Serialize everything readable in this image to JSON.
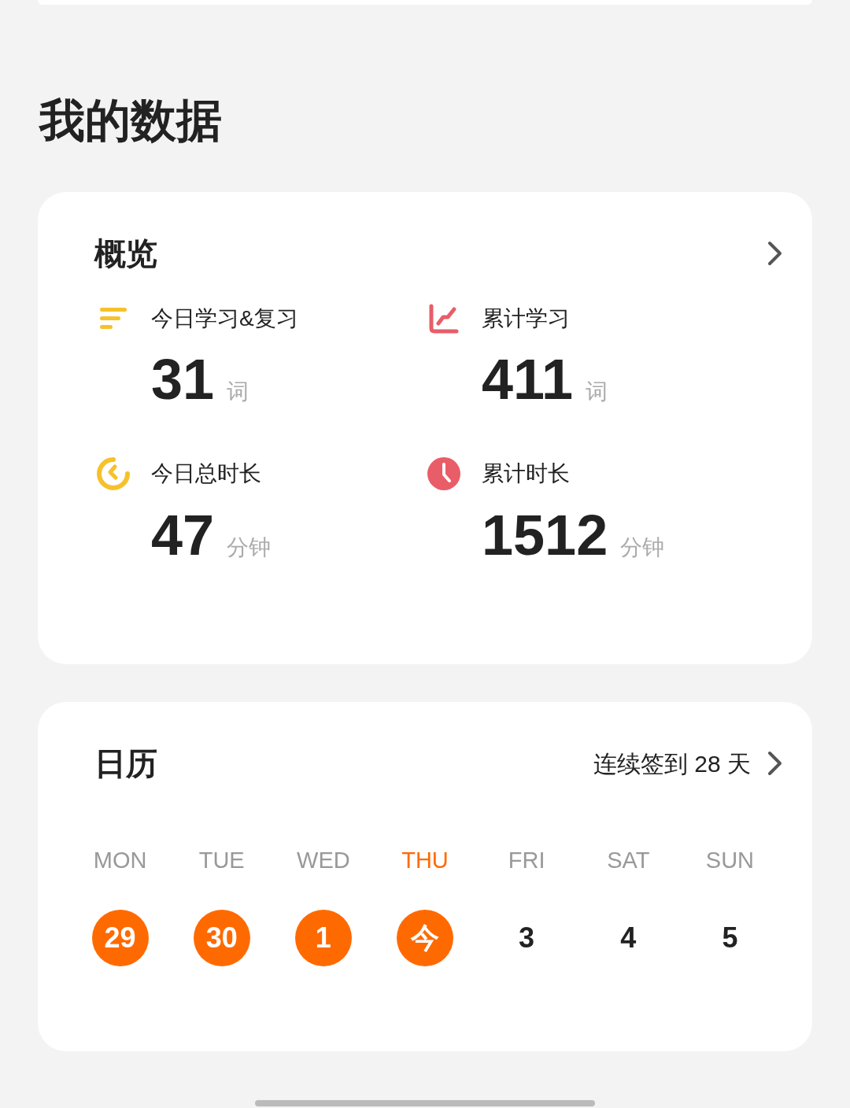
{
  "title": "我的数据",
  "overview": {
    "title": "概览",
    "stats": [
      {
        "kind": "lines",
        "label": "今日学习&复习",
        "value": "31",
        "unit": "词"
      },
      {
        "kind": "chart",
        "label": "累计学习",
        "value": "411",
        "unit": "词"
      },
      {
        "kind": "ring",
        "label": "今日总时长",
        "value": "47",
        "unit": "分钟"
      },
      {
        "kind": "clock",
        "label": "累计时长",
        "value": "1512",
        "unit": "分钟"
      }
    ]
  },
  "calendar": {
    "title": "日历",
    "streak": "连续签到 28 天",
    "days": [
      {
        "weekday": "MON",
        "date": "29",
        "checked": true,
        "selected": false
      },
      {
        "weekday": "TUE",
        "date": "30",
        "checked": true,
        "selected": false
      },
      {
        "weekday": "WED",
        "date": "1",
        "checked": true,
        "selected": false
      },
      {
        "weekday": "THU",
        "date": "今",
        "checked": true,
        "selected": true
      },
      {
        "weekday": "FRI",
        "date": "3",
        "checked": false,
        "selected": false
      },
      {
        "weekday": "SAT",
        "date": "4",
        "checked": false,
        "selected": false
      },
      {
        "weekday": "SUN",
        "date": "5",
        "checked": false,
        "selected": false
      }
    ]
  }
}
